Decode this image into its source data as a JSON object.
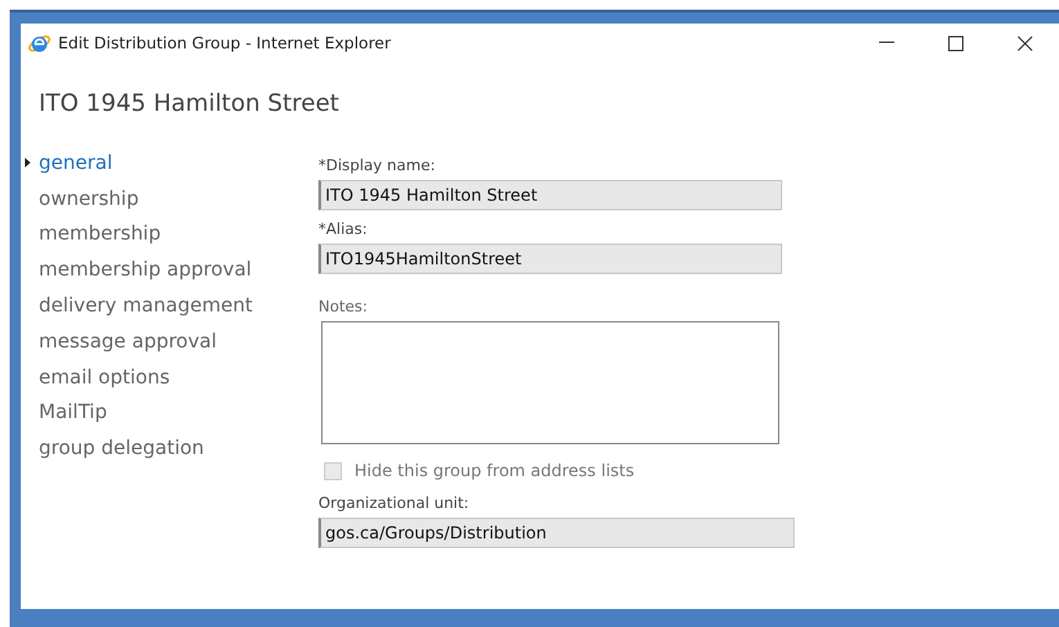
{
  "window": {
    "title": "Edit Distribution Group - Internet Explorer"
  },
  "heading": "ITO 1945 Hamilton Street",
  "nav": [
    {
      "label": "general",
      "selected": true
    },
    {
      "label": "ownership",
      "selected": false
    },
    {
      "label": "membership",
      "selected": false
    },
    {
      "label": "membership approval",
      "selected": false
    },
    {
      "label": "delivery management",
      "selected": false
    },
    {
      "label": "message approval",
      "selected": false
    },
    {
      "label": "email options",
      "selected": false
    },
    {
      "label": "MailTip",
      "selected": false
    },
    {
      "label": "group delegation",
      "selected": false
    }
  ],
  "form": [
    {
      "kind": "text",
      "label": "*Display name:",
      "value": "ITO 1945 Hamilton Street",
      "disabled": true
    },
    {
      "kind": "text",
      "label": "*Alias:",
      "value": "ITO1945HamiltonStreet",
      "disabled": true
    },
    {
      "kind": "textarea",
      "label": "Notes:",
      "disabled": false
    },
    {
      "kind": "checkbox",
      "label": "Hide this group from address lists",
      "checked": false,
      "disabled": true
    },
    {
      "kind": "wide",
      "label": "Organizational unit:",
      "value": "gos.ca/Groups/Distribution",
      "disabled": true
    }
  ]
}
